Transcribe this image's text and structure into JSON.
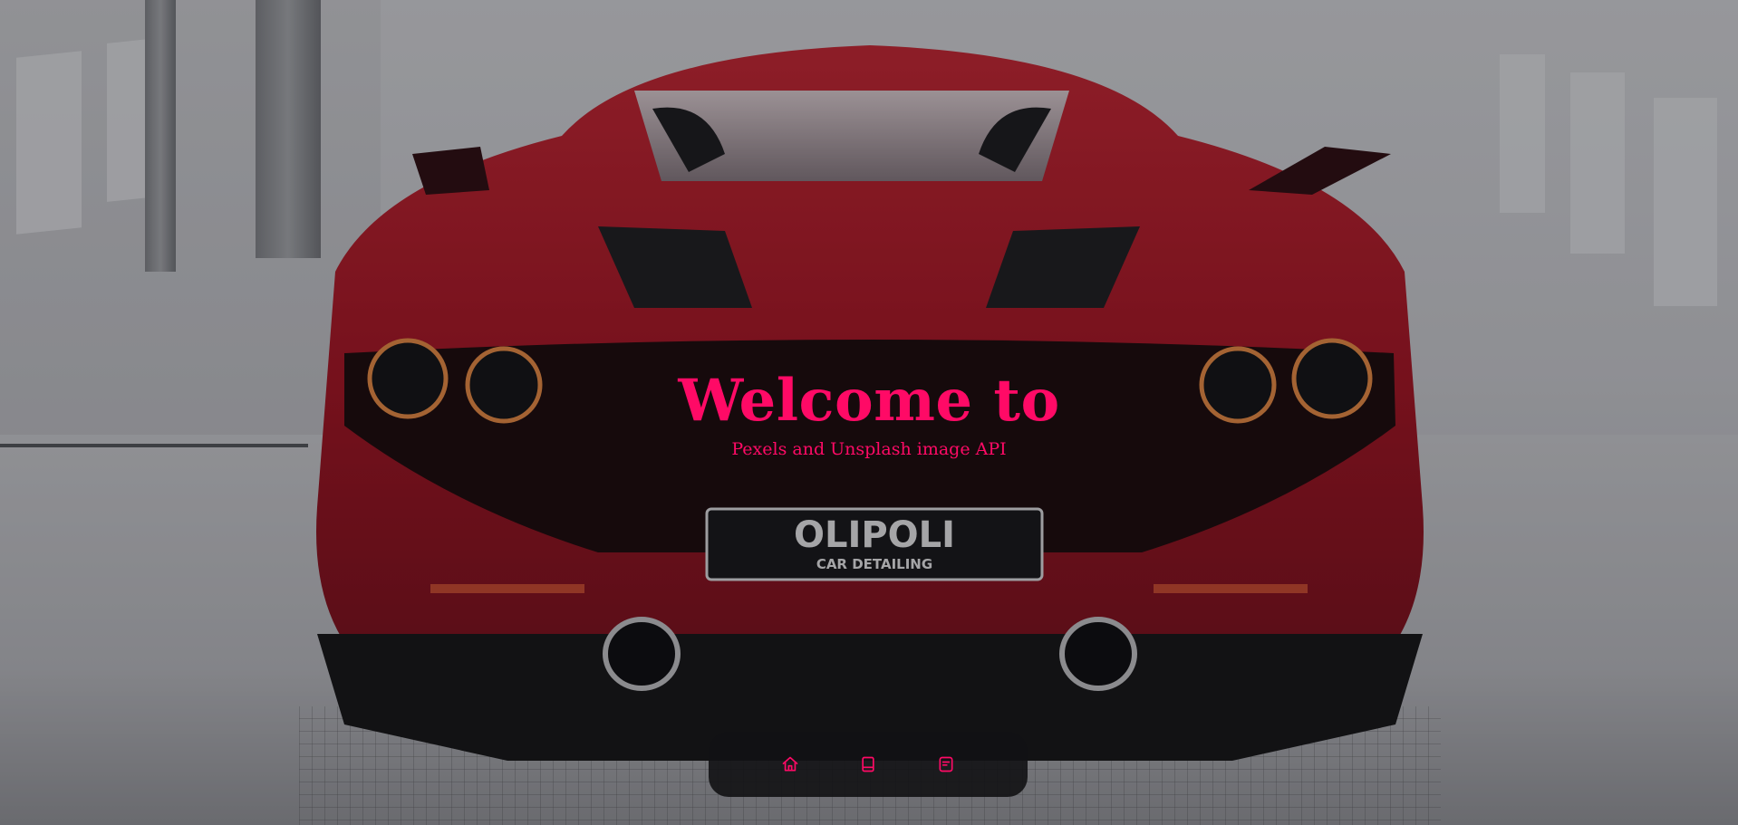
{
  "hero": {
    "title": "Welcome to",
    "subtitle": "Pexels and Unsplash image API",
    "plate_line1": "OLIPOLI",
    "plate_line2": "CAR DETAILING"
  },
  "nav": {
    "items": [
      {
        "icon": "home-icon"
      },
      {
        "icon": "book-icon"
      },
      {
        "icon": "document-icon"
      }
    ]
  },
  "colors": {
    "accent": "#ff0a66",
    "car": "#b0132a",
    "nav_bg": "#121214"
  }
}
